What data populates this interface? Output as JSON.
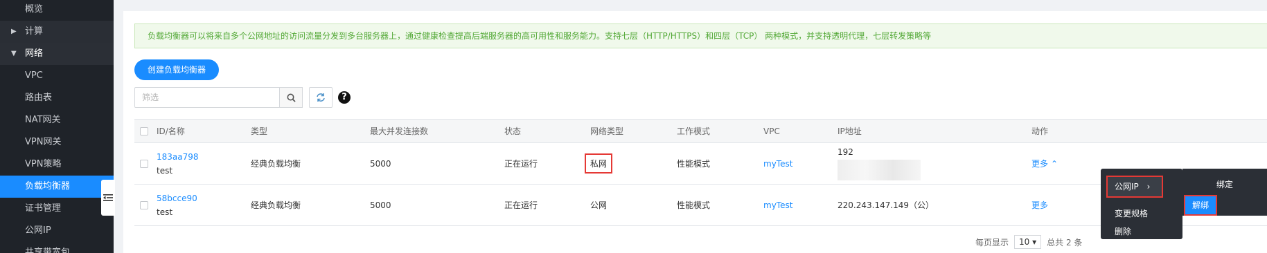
{
  "sidebar": {
    "items": [
      {
        "label": "概览"
      },
      {
        "label": "计算"
      },
      {
        "label": "网络"
      },
      {
        "label": "VPC"
      },
      {
        "label": "路由表"
      },
      {
        "label": "NAT网关"
      },
      {
        "label": "VPN网关"
      },
      {
        "label": "VPN策略"
      },
      {
        "label": "负载均衡器"
      },
      {
        "label": "证书管理"
      },
      {
        "label": "公网IP"
      },
      {
        "label": "共享带宽包"
      }
    ]
  },
  "notice": "负载均衡器可以将来自多个公网地址的访问流量分发到多台服务器上，通过健康检查提高后端服务器的高可用性和服务能力。支持七层（HTTP/HTTPS）和四层（TCP） 两种模式，并支持透明代理，七层转发策略等",
  "toolbar": {
    "create_label": "创建负载均衡器",
    "filter_placeholder": "筛选",
    "help_label": "?"
  },
  "table": {
    "headers": [
      "ID/名称",
      "类型",
      "最大并发连接数",
      "状态",
      "网络类型",
      "工作模式",
      "VPC",
      "IP地址",
      "动作"
    ],
    "rows": [
      {
        "id": "183aa798",
        "name": "test",
        "type": "经典负载均衡",
        "max_conn": "5000",
        "status": "正在运行",
        "net_type": "私网",
        "mode": "性能模式",
        "vpc": "myTest",
        "ip": "192",
        "action": "更多"
      },
      {
        "id": "58bcce90",
        "name": "test",
        "type": "经典负载均衡",
        "max_conn": "5000",
        "status": "正在运行",
        "net_type": "公网",
        "mode": "性能模式",
        "vpc": "myTest",
        "ip": "220.243.147.149（公）",
        "action": "更多"
      }
    ]
  },
  "menu": {
    "items": [
      "公网IP",
      "变更规格",
      "删除"
    ],
    "submenu": [
      "绑定",
      "解绑"
    ]
  },
  "pagination": {
    "per_page_label": "每页显示",
    "per_page": "10",
    "total": "总共 2 条"
  },
  "colors": {
    "accent": "#1a8cff",
    "sidebar_bg": "#1f2329",
    "highlight_red": "#e53935",
    "notice_green": "#52a836"
  }
}
